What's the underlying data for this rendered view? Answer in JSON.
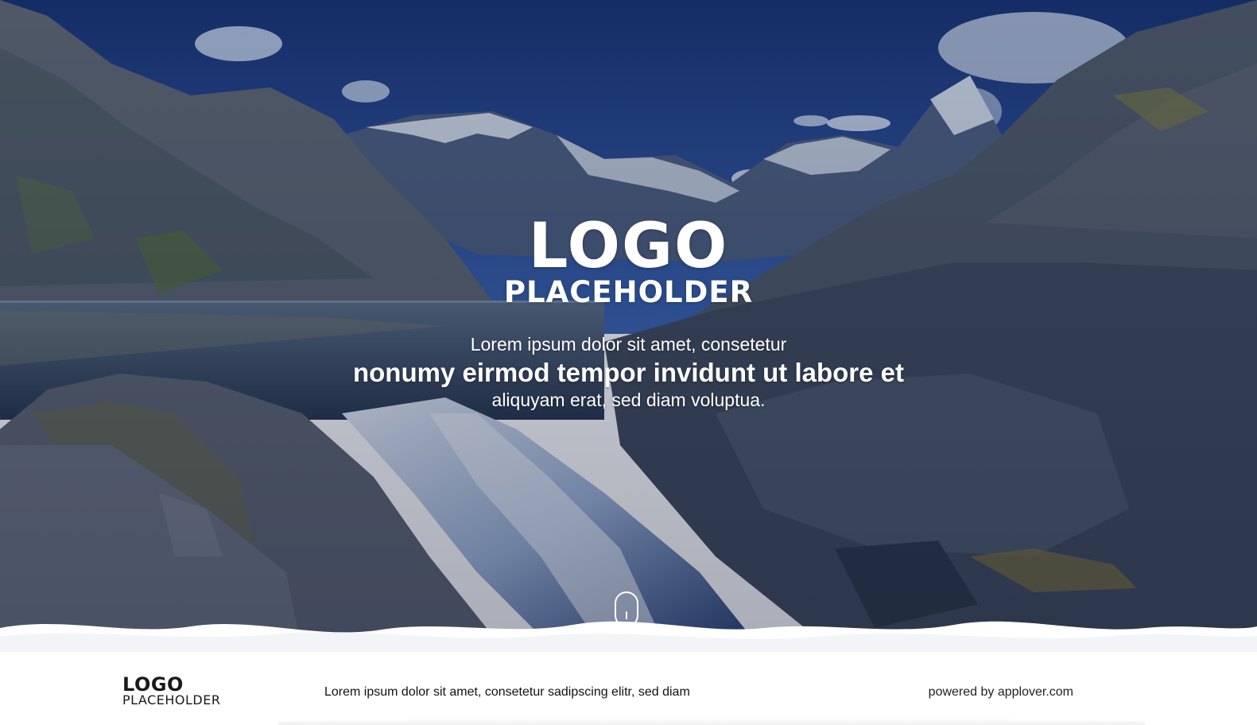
{
  "hero": {
    "logo_main": "LOGO",
    "logo_sub": "PLACEHOLDER",
    "tagline_line1": "Lorem ipsum dolor sit amet, consetetur",
    "tagline_line2": "nonumy eirmod tempor invidunt ut labore et",
    "tagline_line3": "aliquyam erat, sed diam voluptua.",
    "scroll_icon": "mouse-scroll-icon"
  },
  "footer": {
    "logo_main": "LOGO",
    "logo_sub": "PLACEHOLDER",
    "text": "Lorem ipsum dolor sit amet, consetetur sadipscing elitr, sed diam",
    "powered_by": "powered by applover.com"
  },
  "colors": {
    "sky": "#1f3f8a",
    "overlay": "#0d1b45",
    "footer_bg": "#ffffff",
    "text_light": "#ffffff",
    "text_dark": "#111111"
  }
}
